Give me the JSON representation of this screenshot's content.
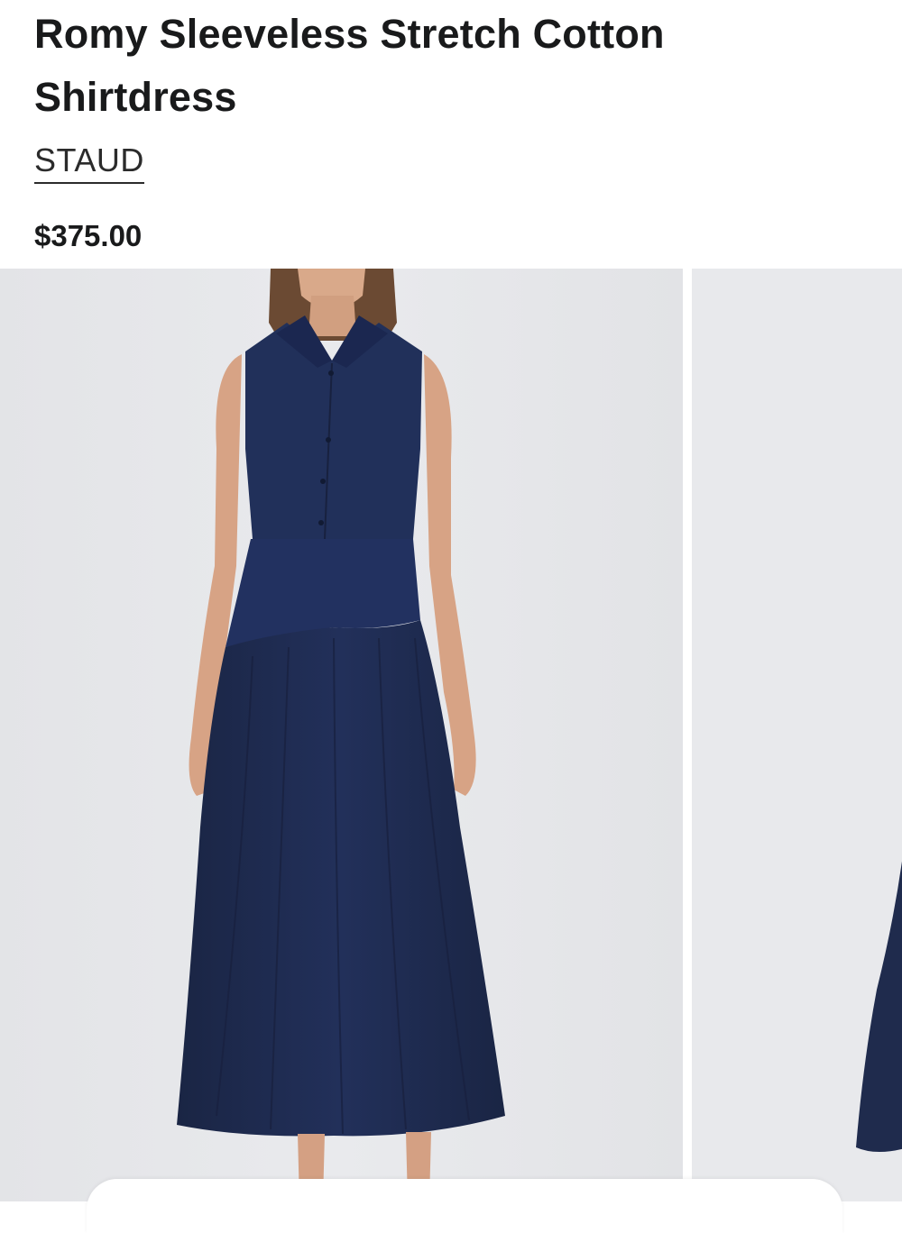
{
  "product": {
    "title": "Romy Sleeveless Stretch Cotton Shirtdress",
    "brand": "STAUD",
    "price": "$375.00"
  },
  "gallery": {
    "images": [
      {
        "description": "model-wearing-navy-sleeveless-shirtdress-front"
      },
      {
        "description": "navy-shirtdress-partial-next-slide"
      }
    ]
  },
  "colors": {
    "dress": "#1f2b4d",
    "background": "#e6e7ea",
    "text": "#191a1b"
  }
}
